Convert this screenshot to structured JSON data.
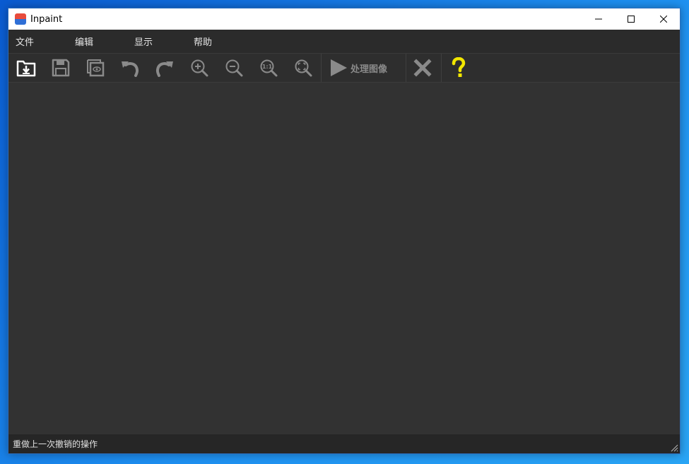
{
  "window": {
    "title": "Inpaint"
  },
  "menu": {
    "items": [
      {
        "label": "文件"
      },
      {
        "label": "编辑"
      },
      {
        "label": "显示"
      },
      {
        "label": "帮助"
      }
    ]
  },
  "toolbar": {
    "process_label": "处理图像",
    "icons": [
      "open-icon",
      "save-icon",
      "preview-icon",
      "undo-icon",
      "redo-icon",
      "zoom-in-icon",
      "zoom-out-icon",
      "zoom-actual-icon",
      "zoom-fit-icon",
      "play-icon",
      "close-x-icon",
      "help-icon"
    ]
  },
  "status": {
    "text": "重做上一次撤销的操作"
  },
  "colors": {
    "help": "#f2e600",
    "icon_active": "#ffffff",
    "icon_disabled": "#8a8a8a"
  }
}
